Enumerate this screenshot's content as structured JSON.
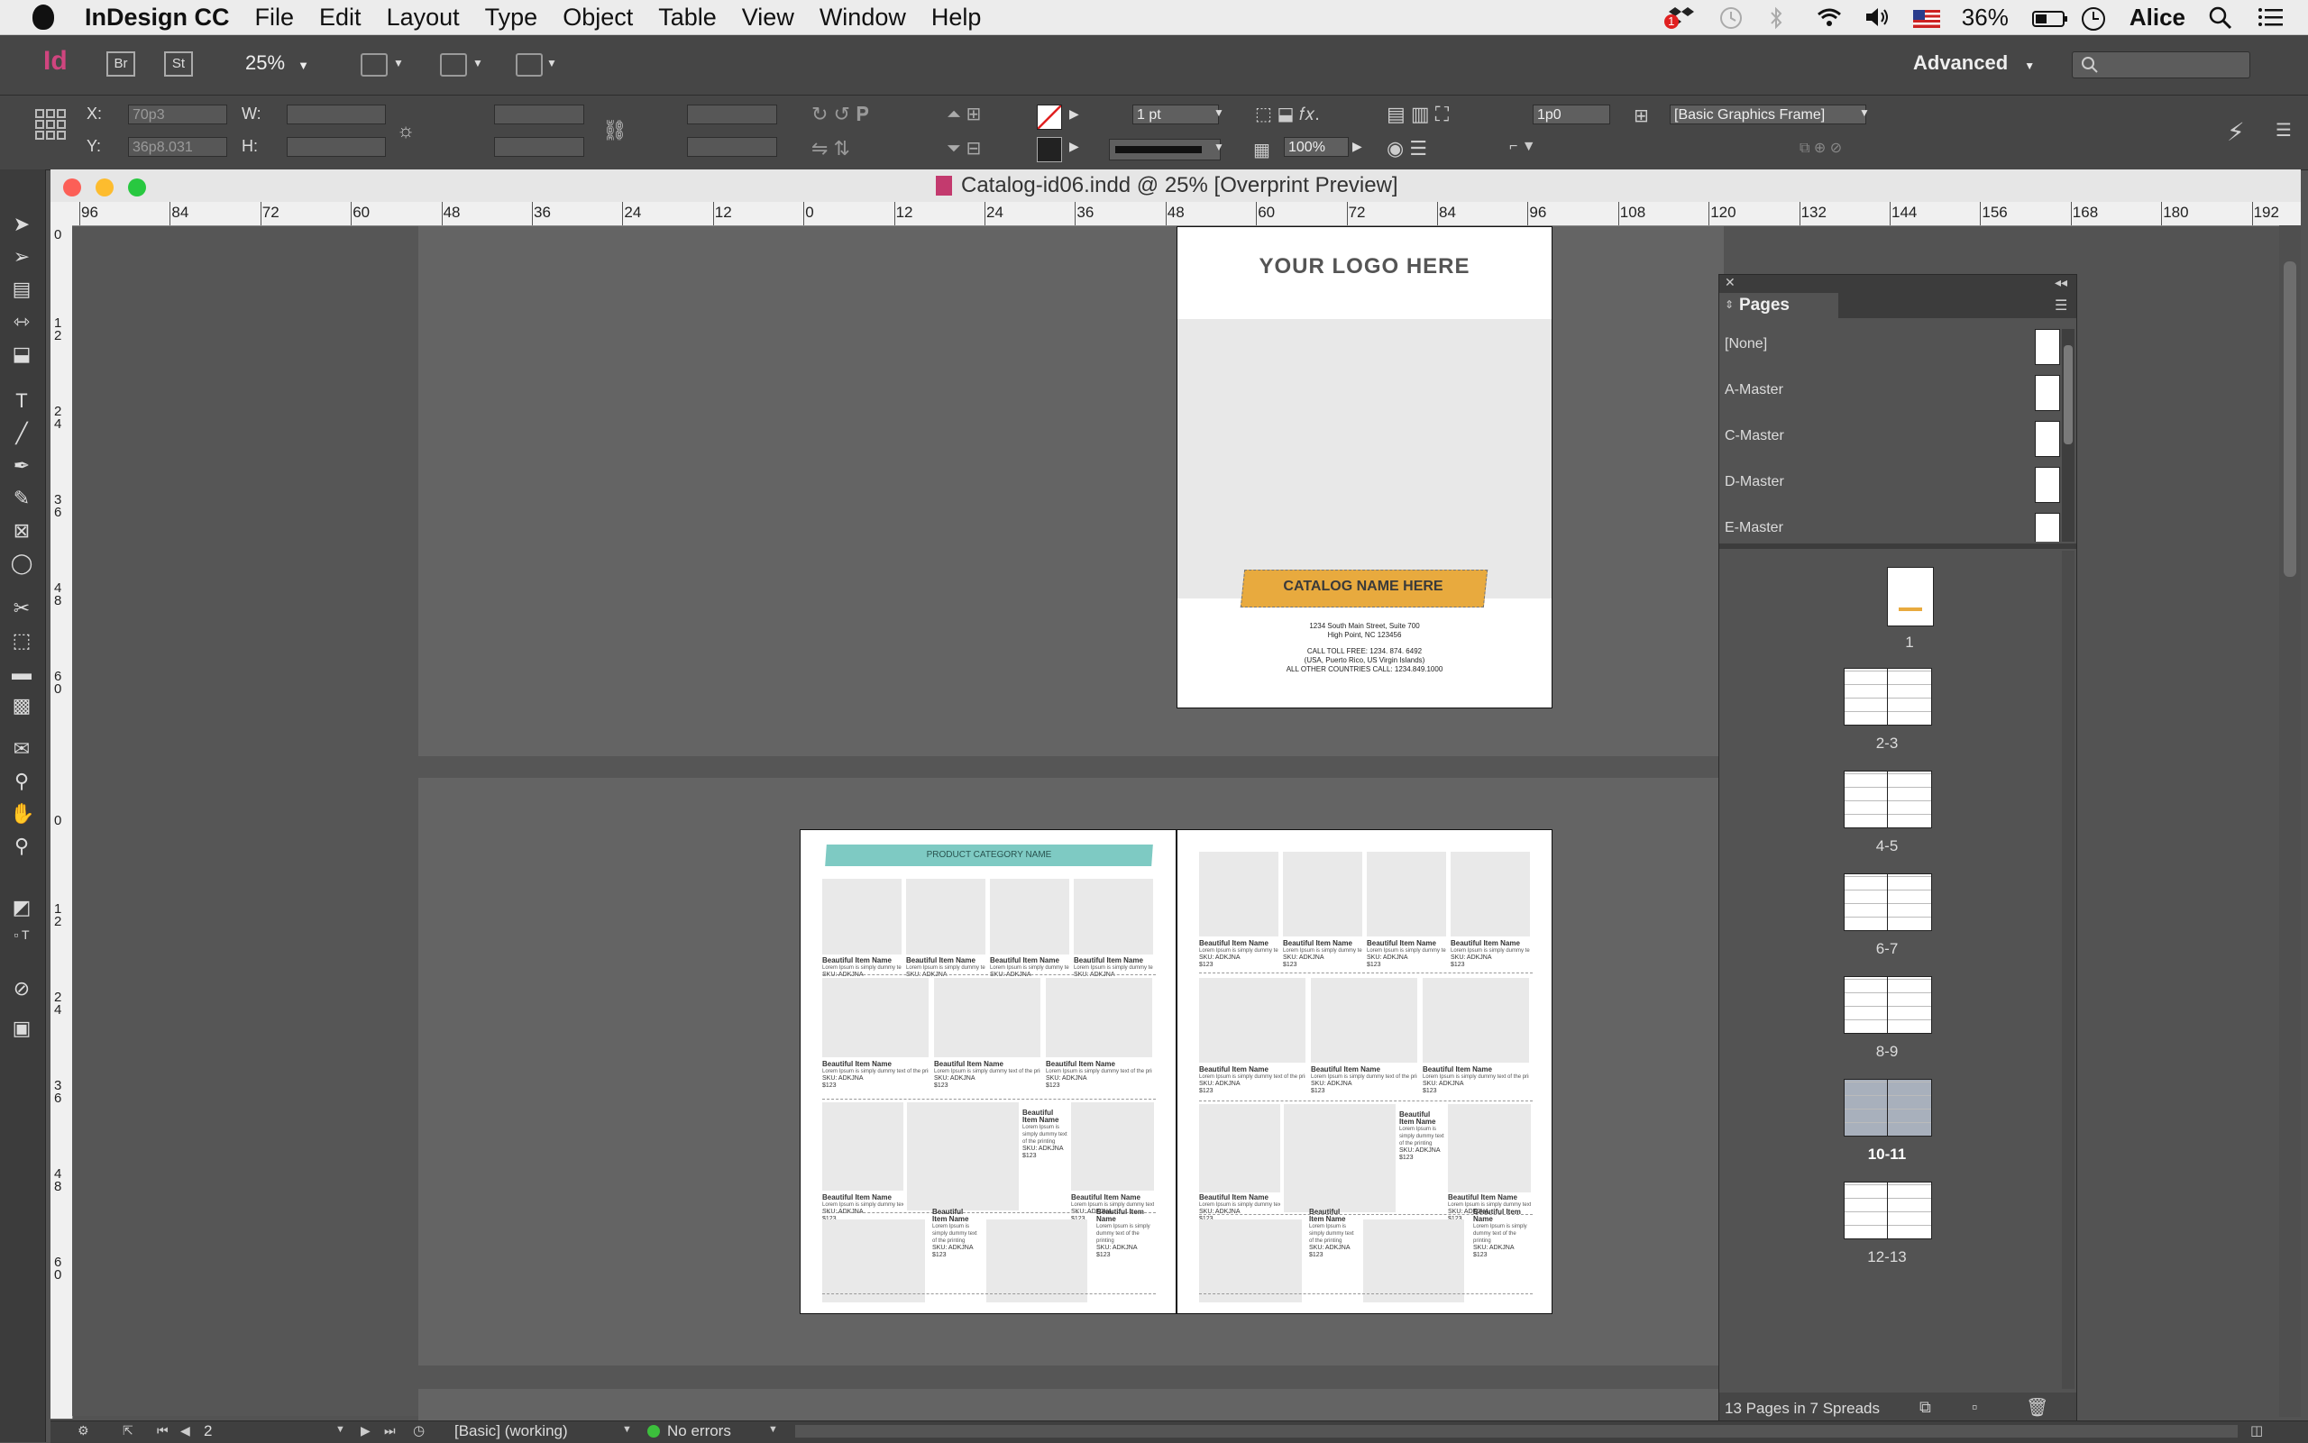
{
  "menubar": {
    "app_name": "InDesign CC",
    "menus": [
      "File",
      "Edit",
      "Layout",
      "Type",
      "Object",
      "Table",
      "View",
      "Window",
      "Help"
    ],
    "battery": "36%",
    "user": "Alice",
    "badge_count": "1"
  },
  "appbar": {
    "app_icon": "Id",
    "bridge": "Br",
    "stock": "St",
    "zoom": "25%",
    "workspace": "Advanced"
  },
  "control": {
    "x_label": "X:",
    "x_value": "70p3",
    "y_label": "Y:",
    "y_value": "36p8.031",
    "w_label": "W:",
    "h_label": "H:",
    "stroke_weight": "1 pt",
    "opacity": "100%",
    "offset": "1p0",
    "object_style": "[Basic Graphics Frame]"
  },
  "document": {
    "title": "Catalog-id06.indd @ 25% [Overprint Preview]",
    "ruler_labels": [
      "96",
      "84",
      "72",
      "60",
      "48",
      "36",
      "24",
      "12",
      "0",
      "12",
      "24",
      "36",
      "48",
      "60",
      "72",
      "84",
      "96",
      "108",
      "120",
      "132",
      "144",
      "156",
      "168",
      "180",
      "192"
    ],
    "vruler_labels": [
      "0",
      "1 2",
      "2 4",
      "3 6",
      "4 8",
      "6 0",
      "0",
      "1 2",
      "2 4",
      "3 6",
      "4 8",
      "6 0"
    ]
  },
  "cover": {
    "logo": "YOUR LOGO HERE",
    "catalog_name": "CATALOG NAME HERE",
    "address1": "1234 South Main Street, Suite 700",
    "address2": "High Point, NC 123456",
    "call1": "CALL TOLL FREE: 1234. 874. 6492",
    "call2": "(USA, Puerto Rico, US Virgin Islands)",
    "call3": "ALL OTHER COUNTRIES CALL: 1234.849.1000"
  },
  "spread": {
    "category": "PRODUCT CATEGORY NAME",
    "item_name": "Beautiful Item Name",
    "item_desc": "Lorem Ipsum is simply dummy text of the printing",
    "item_sku": "SKU: ADKJNA",
    "item_price": "$123"
  },
  "pages_panel": {
    "title": "Pages",
    "masters": [
      "[None]",
      "A-Master",
      "C-Master",
      "D-Master",
      "E-Master"
    ],
    "spreads": [
      "1",
      "2-3",
      "4-5",
      "6-7",
      "8-9",
      "10-11",
      "12-13"
    ],
    "summary": "13 Pages in 7 Spreads"
  },
  "status": {
    "page": "2",
    "profile": "[Basic] (working)",
    "errors": "No errors"
  },
  "colors": {
    "accent_teal": "#7ecac3",
    "accent_orange": "#e8aa3e",
    "menu_bg": "#ececec",
    "panel_bg": "#464646"
  }
}
